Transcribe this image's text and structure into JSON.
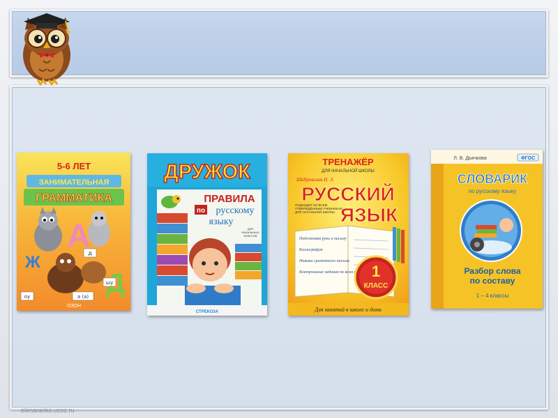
{
  "slide": {
    "colors": {
      "header": "#c2d3ea",
      "content": "#dbe4f0",
      "border": "#eef1f5"
    },
    "owl_icon": "owl-graduate-icon",
    "watermark": "elenaranko.ucoz.ru"
  },
  "books": [
    {
      "age": "5-6 ЛЕТ",
      "title_line1": "ЗАНИМАТЕЛЬНАЯ",
      "title_line2": "ГРАММАТИКА",
      "letter_a": "А",
      "letter_d": "Д",
      "letter_zh": "Ж",
      "word_d": "д",
      "word_ou": "оу",
      "word_shu": "шу",
      "word_a": "а (а)",
      "publisher": "ОЗОН",
      "colors": {
        "cover": "#f7b23d",
        "title": "#ec3a2d"
      }
    },
    {
      "series": "ДРУЖОК",
      "title_line1": "ПРАВИЛА",
      "title_po": "по",
      "title_line2": "русскому",
      "title_line3": "языку",
      "subtitle_line1": "ДЛЯ",
      "subtitle_line2": "НАЧАЛЬНЫХ",
      "subtitle_line3": "КЛАССОВ",
      "publisher": "СТРЕКОЗА",
      "colors": {
        "cover": "#1da7d9",
        "series": "#d8282f"
      }
    },
    {
      "series_line1": "ТРЕНАЖЁР",
      "series_line2": "ДЛЯ НАЧАЛЬНОЙ ШКОЛЫ",
      "author": "Шабровская Н. Э.",
      "title_line1": "РУССКИЙ",
      "title_line2": "ЯЗЫК",
      "note_line1": "ПОДХОДИТ КО ВСЕМ",
      "note_line2": "УТВЕРЖДЁННЫМ УЧЕБНИКАМ",
      "note_line3": "ДЛЯ НАЧАЛЬНОЙ ШКОЛЫ",
      "list": [
        "Подготовка руки к письму",
        "Каллиграфия",
        "Навыки грамотного письма",
        "Контрольные задания по всем темам"
      ],
      "grade_number": "1",
      "grade_word": "КЛАСС",
      "footer": "Для занятий в школе и дома",
      "colors": {
        "cover": "#f7c62b",
        "title": "#d8231c"
      }
    },
    {
      "author": "Л. В. Дьячкова",
      "badge": "ФГОС",
      "title": "СЛОВАРИК",
      "subtitle": "по русскому языку",
      "desc_line1": "Разбор слова",
      "desc_line2": "по составу",
      "grades": "1 – 4 классы",
      "colors": {
        "cover": "#f6c326",
        "title": "#1c6fb7"
      }
    }
  ]
}
